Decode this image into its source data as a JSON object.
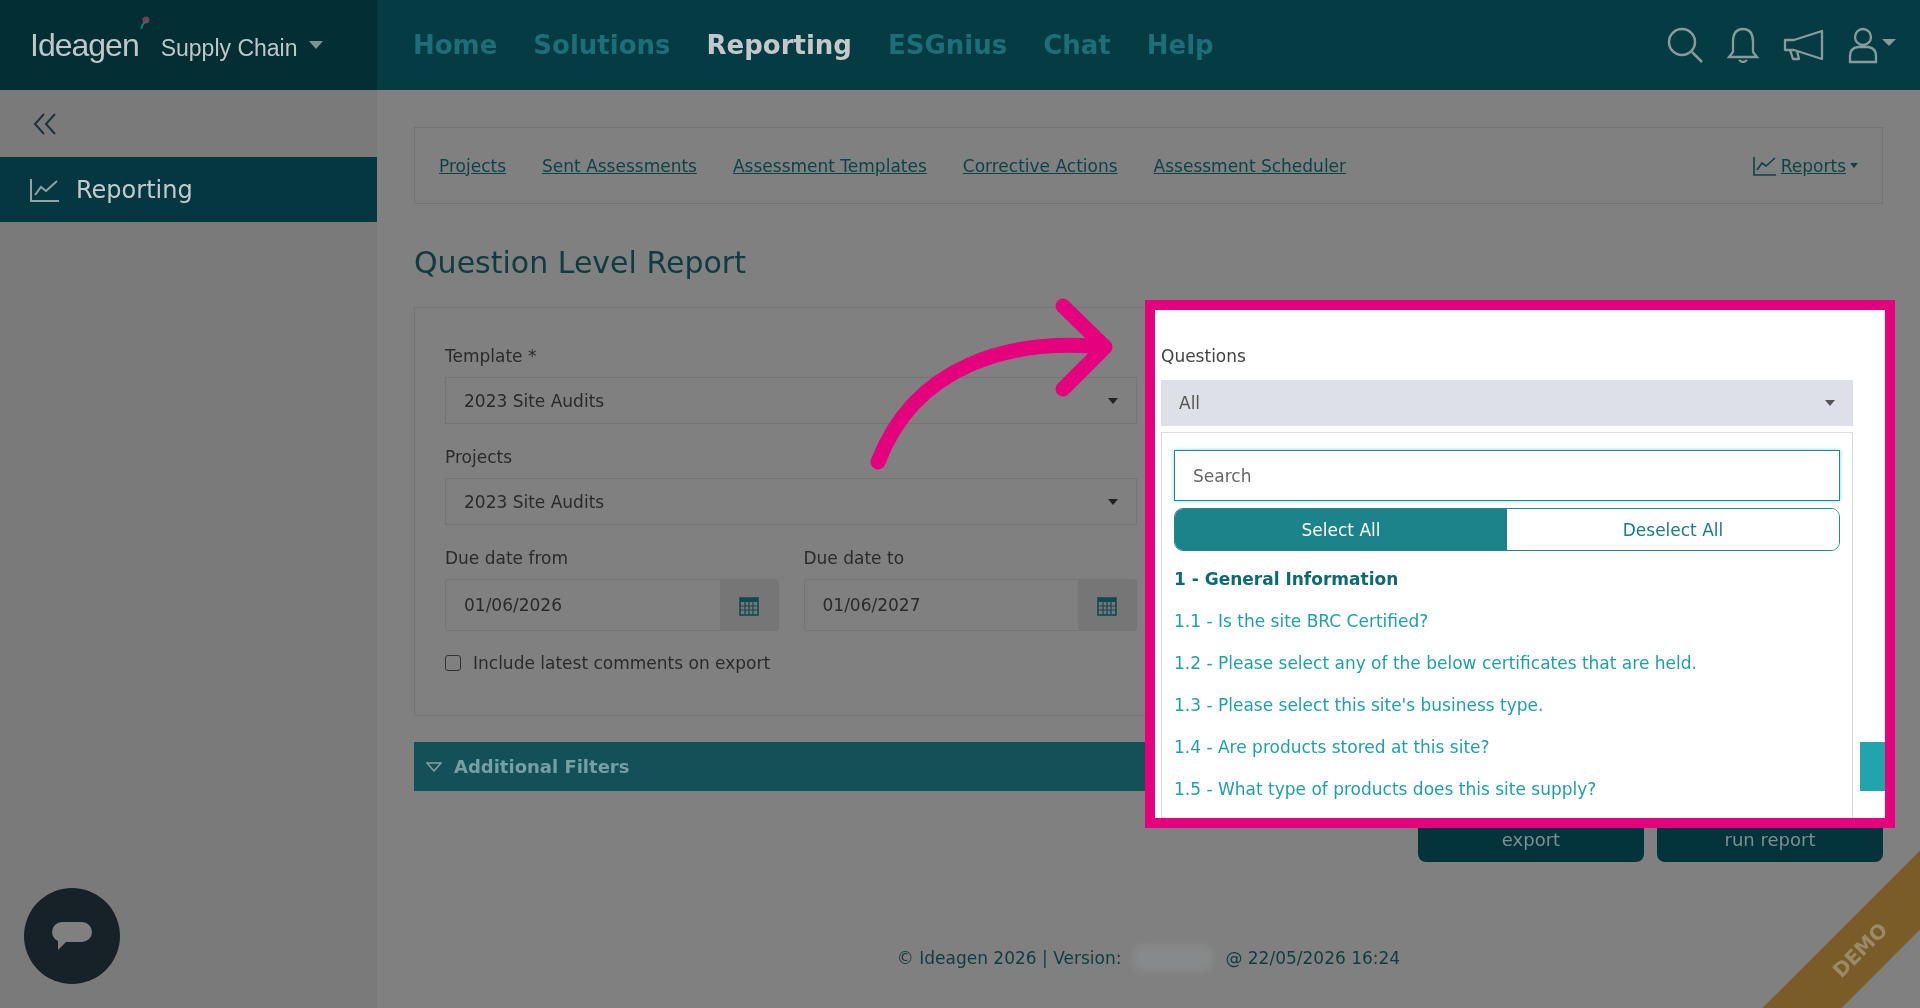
{
  "header": {
    "logo": "Ideagen",
    "product": "Supply Chain",
    "nav": [
      {
        "label": "Home",
        "selected": false
      },
      {
        "label": "Solutions",
        "selected": false
      },
      {
        "label": "Reporting",
        "selected": true
      },
      {
        "label": "ESGnius",
        "selected": false
      },
      {
        "label": "Chat",
        "selected": false
      },
      {
        "label": "Help",
        "selected": false
      }
    ]
  },
  "sidebar": {
    "items": [
      {
        "label": "Reporting",
        "selected": true
      }
    ]
  },
  "subnav": {
    "links": [
      "Projects",
      "Sent Assessments",
      "Assessment Templates",
      "Corrective Actions",
      "Assessment Scheduler"
    ],
    "reports": "Reports"
  },
  "page_title": "Question Level Report",
  "form": {
    "template": {
      "label": "Template *",
      "value": "2023 Site Audits"
    },
    "projects": {
      "label": "Projects",
      "value": "2023 Site Audits"
    },
    "dates": [
      {
        "label": "Due date from",
        "value": "01/06/2026"
      },
      {
        "label": "Due date to",
        "value": "01/06/2027"
      }
    ],
    "comments": {
      "label": "Include latest comments on export",
      "checked": false
    }
  },
  "additional_filters": "Additional Filters",
  "questions": {
    "label": "Questions",
    "value": "All",
    "search": {
      "placeholder": "Search"
    },
    "toggle": [
      {
        "label": "Select All",
        "selected": true
      },
      {
        "label": "Deselect All",
        "selected": false
      }
    ],
    "options": [
      {
        "kind": "group",
        "label": "1 - General Information"
      },
      {
        "kind": "question",
        "label": "1.1 - Is the site BRC Certified?"
      },
      {
        "kind": "question",
        "label": "1.2 - Please select any of the below certificates that are held."
      },
      {
        "kind": "question",
        "label": "1.3 - Please select this site's business type."
      },
      {
        "kind": "question",
        "label": "1.4 - Are products stored at this site?"
      },
      {
        "kind": "question",
        "label": "1.5 - What type of products does this site supply?"
      }
    ]
  },
  "buttons": [
    "export",
    "run report"
  ],
  "footer": {
    "copyright": "© Ideagen 2026 | Version:",
    "timestamp": "@ 22/05/2026 16:24"
  },
  "ribbon": "DEMO"
}
